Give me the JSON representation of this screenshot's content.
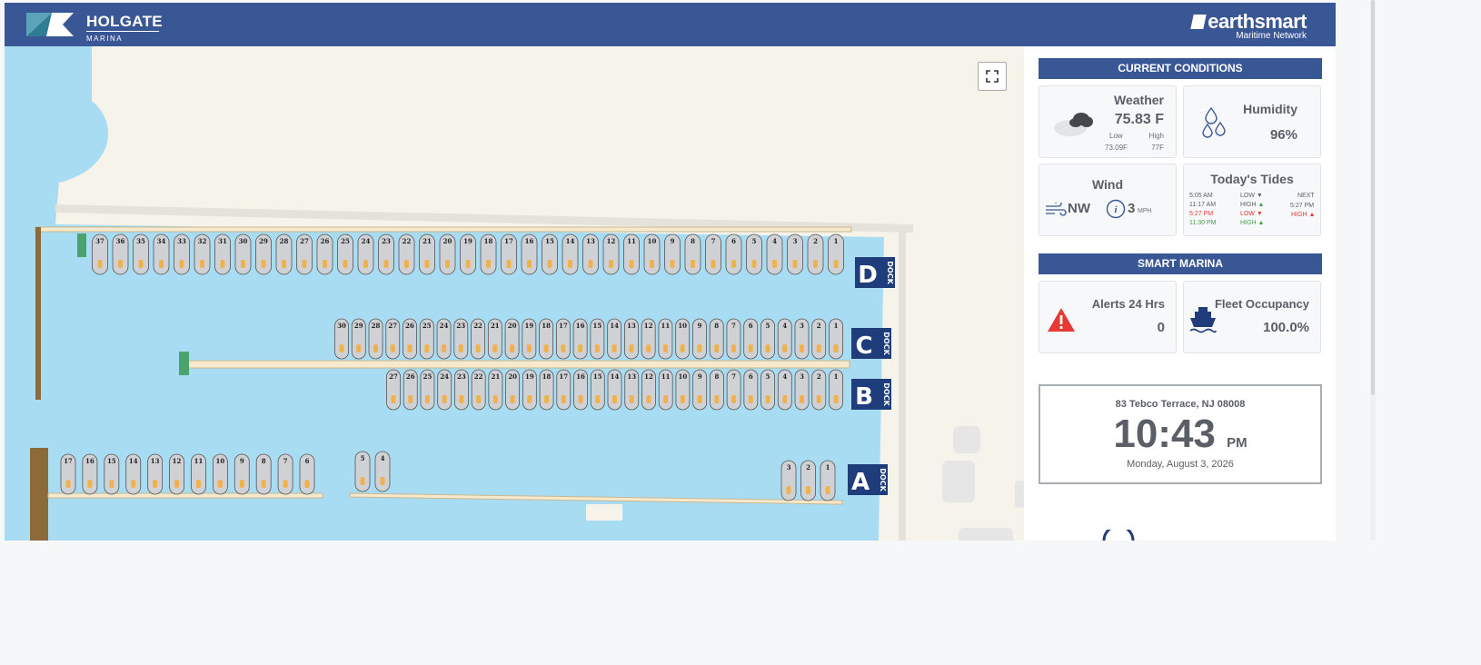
{
  "header": {
    "marina_name": "HOLGATE",
    "marina_sub": "MARINA",
    "brand_name": "earthsmart",
    "brand_sub": "Maritime Network"
  },
  "colors": {
    "header_bg": "#3a5795",
    "water": "#a8dcf3",
    "land": "#f6f3ea",
    "dock_label_bg": "#1f3d7a",
    "alert_red": "#e53935",
    "tide_low": "#e53935",
    "tide_high": "#43a047"
  },
  "map": {
    "docks": [
      {
        "letter": "D",
        "label": "DOCK",
        "slips": [
          "37",
          "36",
          "35",
          "34",
          "33",
          "32",
          "31",
          "30",
          "29",
          "28",
          "27",
          "26",
          "25",
          "24",
          "23",
          "22",
          "21",
          "20",
          "19",
          "18",
          "17",
          "16",
          "15",
          "14",
          "13",
          "12",
          "11",
          "10",
          "9",
          "8",
          "7",
          "6",
          "5",
          "4",
          "3",
          "2",
          "1"
        ]
      },
      {
        "letter": "C",
        "label": "DOCK",
        "slips": [
          "30",
          "29",
          "28",
          "27",
          "26",
          "25",
          "24",
          "23",
          "22",
          "21",
          "20",
          "19",
          "18",
          "17",
          "16",
          "15",
          "14",
          "13",
          "12",
          "11",
          "10",
          "9",
          "8",
          "7",
          "6",
          "5",
          "4",
          "3",
          "2",
          "1"
        ]
      },
      {
        "letter": "B",
        "label": "DOCK",
        "slips": [
          "27",
          "26",
          "25",
          "24",
          "23",
          "22",
          "21",
          "20",
          "19",
          "18",
          "17",
          "16",
          "15",
          "14",
          "13",
          "12",
          "11",
          "10",
          "9",
          "8",
          "7",
          "6",
          "5",
          "4",
          "3",
          "2",
          "1"
        ]
      },
      {
        "letter": "A",
        "label": "DOCK",
        "slips": [
          "17",
          "16",
          "15",
          "14",
          "13",
          "12",
          "11",
          "10",
          "9",
          "8",
          "7",
          "6",
          "5",
          "4",
          "3",
          "2",
          "1"
        ]
      }
    ],
    "fullscreen_icon": "expand-icon"
  },
  "conditions": {
    "header": "CURRENT CONDITIONS",
    "weather": {
      "title": "Weather",
      "temp": "75.83 F",
      "low_label": "Low",
      "high_label": "High",
      "low": "73.09F",
      "high": "77F",
      "icon": "cloudy-night-icon"
    },
    "humidity": {
      "title": "Humidity",
      "value": "96%",
      "icon": "droplets-icon"
    },
    "wind": {
      "title": "Wind",
      "direction": "NW",
      "speed": "3",
      "unit": "MPH",
      "icon": "wind-icon"
    },
    "tides": {
      "title": "Today's Tides",
      "rows": [
        {
          "time": "5:05 AM",
          "type": "LOW",
          "color": "#5a5e66"
        },
        {
          "time": "11:17 AM",
          "type": "HIGH",
          "color": "#5a5e66"
        },
        {
          "time": "5:27 PM",
          "type": "LOW",
          "color": "#e53935"
        },
        {
          "time": "11:30 PM",
          "type": "HIGH",
          "color": "#43a047"
        }
      ],
      "next_label": "NEXT",
      "next_time": "5:27 PM",
      "next_type": "HIGH"
    }
  },
  "smart_marina": {
    "header": "SMART MARINA",
    "alerts": {
      "title": "Alerts 24 Hrs",
      "value": "0",
      "icon": "alert-triangle-icon"
    },
    "occupancy": {
      "title": "Fleet Occupancy",
      "value": "100.0%",
      "icon": "boat-icon"
    }
  },
  "clock": {
    "address": "83 Tebco Terrace, NJ 08008",
    "time": "10:43",
    "ampm": "PM",
    "date": "Monday, August 3, 2026"
  }
}
